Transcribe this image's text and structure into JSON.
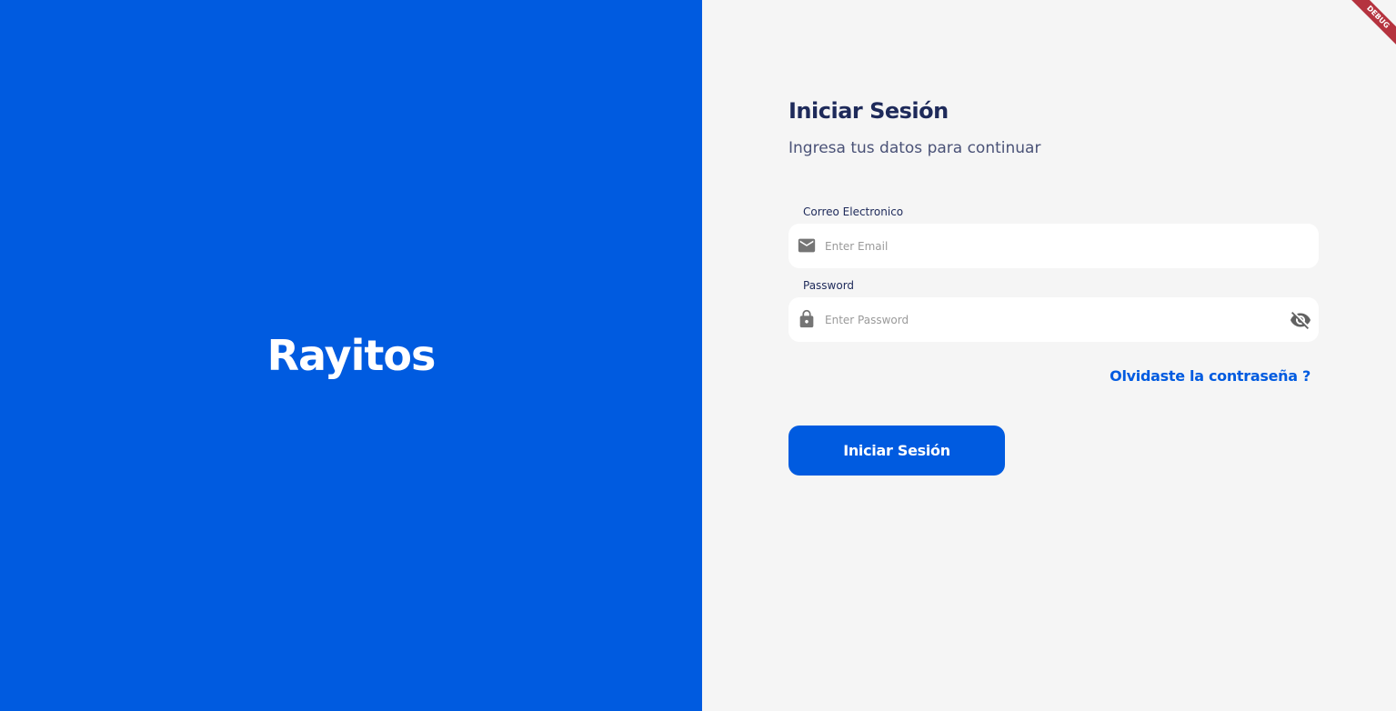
{
  "brand": {
    "name": "Rayitos"
  },
  "login": {
    "title": "Iniciar Sesión",
    "subtitle": "Ingresa tus datos para continuar",
    "email": {
      "label": "Correo Electronico",
      "placeholder": "Enter Email",
      "value": "",
      "icon": "mail-icon"
    },
    "password": {
      "label": "Password",
      "placeholder": "Enter Password",
      "value": "",
      "icon": "lock-icon",
      "toggle_icon": "eye-off-icon"
    },
    "forgot_link": "Olvidaste la contraseña ?",
    "submit_label": "Iniciar Sesión"
  },
  "debug": {
    "label": "DEBUG"
  },
  "colors": {
    "primary": "#005BE0",
    "background": "#F5F5F5",
    "title": "#1E2A5A",
    "debug_banner": "#B5333F"
  }
}
